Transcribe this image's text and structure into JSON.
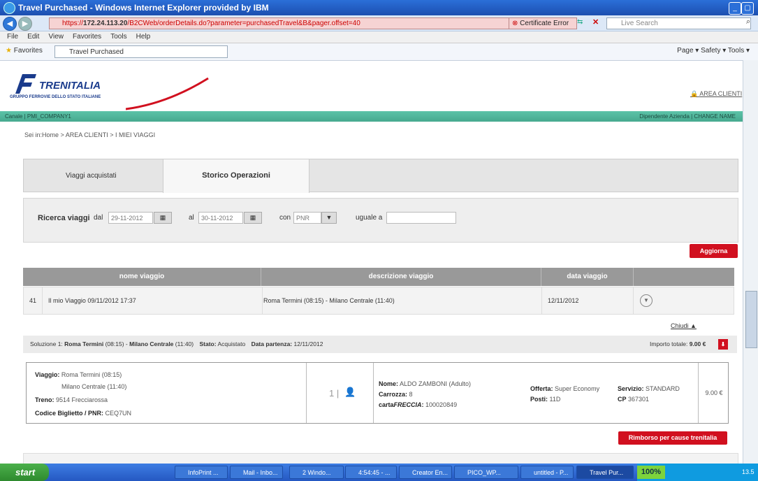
{
  "window": {
    "title": "Travel Purchased - Windows Internet Explorer provided by IBM",
    "url_host": "172.24.113.20",
    "url_path": "/B2CWeb/orderDetails.do?parameter=purchasedTravel&B&pager.offset=40",
    "url_prefix": "https://",
    "cert_error": "Certificate Error",
    "live_search": "Live Search",
    "menu": [
      "File",
      "Edit",
      "View",
      "Favorites",
      "Tools",
      "Help"
    ],
    "favorites": "Favorites",
    "tab_title": "Travel Purchased",
    "toolbar_right": "Page ▾  Safety ▾  Tools ▾"
  },
  "brand": {
    "logo_name": "TRENITALIA",
    "logo_sub": "GRUPPO FERROVIE DELLO STATO ITALIANE",
    "area_clienti": "AREA CLIENTI",
    "canale": "Canale | PMI_COMPANY1",
    "dipendente": "Dipendente Azienda | CHANGE NAME",
    "accent": "#d1101f"
  },
  "breadcrumb": "Sei in:Home  >  AREA CLIENTI   > I MIEI VIAGGI",
  "tabs": {
    "viaggi": "Viaggi acquistati",
    "storico": "Storico Operazioni"
  },
  "search": {
    "label": "Ricerca viaggi",
    "dal": "dal",
    "dal_value": "29-11-2012",
    "al": "al",
    "al_value": "30-11-2012",
    "con": "con",
    "con_value": "PNR",
    "uguale": "uguale a",
    "uguale_value": ""
  },
  "buttons": {
    "aggiorna": "Aggiorna",
    "chiudi": "Chiudi",
    "rimborso": "Rimborso per cause trenitalia"
  },
  "table": {
    "headers": [
      "nome viaggio",
      "descrizione viaggio",
      "data viaggio"
    ],
    "row": {
      "id": "41",
      "nome": "Il mio Viaggio 09/11/2012 17:37",
      "descrizione": "Roma Termini (08:15) - Milano Centrale (11:40)",
      "data": "12/11/2012"
    }
  },
  "solution": {
    "prefix": "Soluzione 1:",
    "route_a": "Roma Termini",
    "time_a": "(08:15)",
    "dash": "-",
    "route_b": "Milano Centrale",
    "time_b": "(11:40)",
    "stato_label": "Stato:",
    "stato": "Acquistato",
    "partenza_label": "Data partenza:",
    "partenza": "12/11/2012",
    "importo_label": "Importo totale:",
    "importo": "9.00 €"
  },
  "card": {
    "viaggio_label": "Viaggio:",
    "viaggio_a": "Roma Termini (08:15)",
    "viaggio_b": "Milano Centrale (11:40)",
    "treno_label": "Treno:",
    "treno": "9514 Frecciarossa",
    "codice_label": "Codice Biglietto / PNR:",
    "codice": "CEQ7UN",
    "passengers": "1 |",
    "nome_label": "Nome:",
    "nome": "ALDO  ZAMBONI (Adulto)",
    "carrozza_label": "Carrozza:",
    "carrozza": "8",
    "carta_label": "carta",
    "carta_italic": "FRECCIA",
    "carta_colon": ":",
    "carta": "100020849",
    "offerta_label": "Offerta:",
    "offerta": "Super Economy",
    "posti_label": "Posti:",
    "posti": "11D",
    "servizio_label": "Servizio:",
    "servizio": "STANDARD",
    "cp_label": "CP",
    "cp": "367301",
    "price": "9.00 €"
  },
  "taskbar": {
    "start": "start",
    "items": [
      "InfoPrint ...",
      "Mail - Inbo...",
      "2 Windo...",
      "4:54:45 - ...",
      "Creator En...",
      "PICO_WP...",
      "untitled - P...",
      "Travel Pur..."
    ],
    "zoom": "100%",
    "clock": "13.5"
  }
}
